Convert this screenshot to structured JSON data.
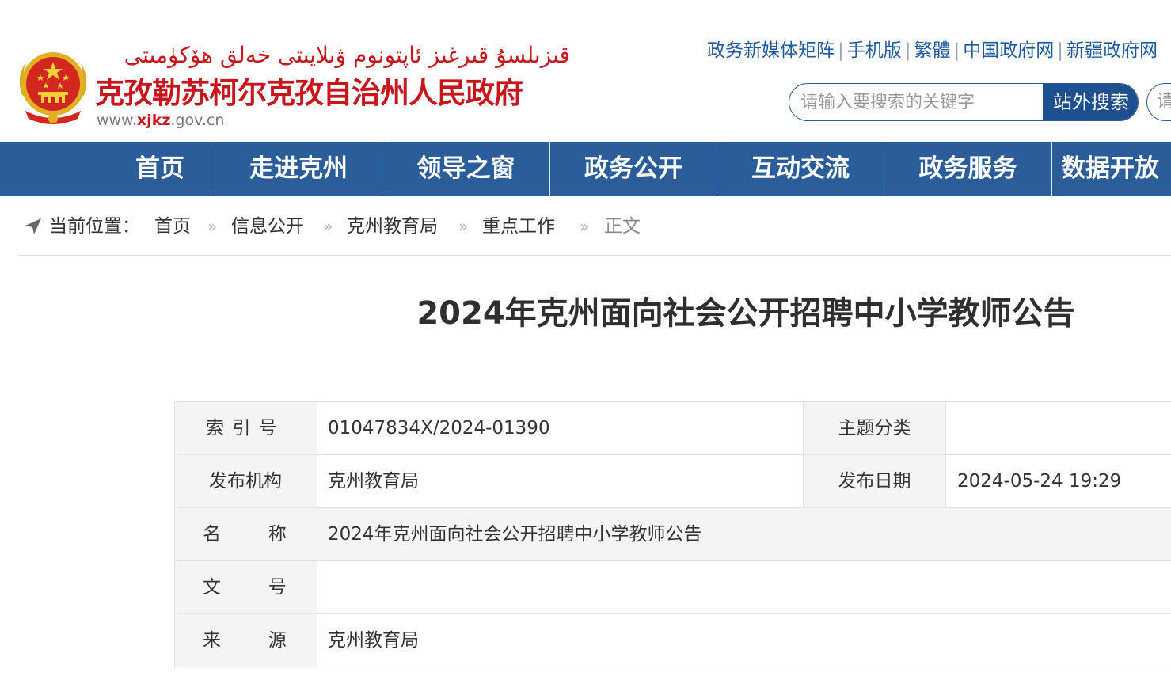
{
  "header": {
    "site_name_uyghur": "قىزىلسۇ قىرغىز ئاپتونوم ۋىلايىتى خەلق ھۆكۈمىتى",
    "site_name": "克孜勒苏柯尔克孜自治州人民政府",
    "site_url": {
      "prefix": "www.",
      "accent": "xjkz",
      "suffix": ".gov.cn"
    },
    "top_links": [
      "政务新媒体矩阵",
      "手机版",
      "繁體",
      "中国政府网",
      "新疆政府网"
    ],
    "search": {
      "placeholder": "请输入要搜索的关键字",
      "button": "站外搜索",
      "second_placeholder": "请"
    }
  },
  "nav": {
    "items": [
      "首页",
      "走进克州",
      "领导之窗",
      "政务公开",
      "互动交流",
      "政务服务",
      "数据开放"
    ]
  },
  "breadcrumb": {
    "label": "当前位置：",
    "items": [
      "首页",
      "信息公开",
      "克州教育局",
      "重点工作"
    ],
    "current": "正文",
    "separator": "»"
  },
  "article": {
    "title": "2024年克州面向社会公开招聘中小学教师公告",
    "meta": {
      "index_label": "索引号",
      "index_value": "01047834X/2024-01390",
      "topic_label": "主题分类",
      "topic_value": "",
      "publisher_label": "发布机构",
      "publisher_value": "克州教育局",
      "date_label": "发布日期",
      "date_value": "2024-05-24 19:29",
      "name_label": "名称",
      "name_value": "2024年克州面向社会公开招聘中小学教师公告",
      "doc_no_label": "文号",
      "doc_no_value": "",
      "source_label": "来源",
      "source_value": "克州教育局"
    }
  },
  "colors": {
    "brand_red": "#c8161d",
    "nav_blue": "#2b5d9b",
    "link_blue": "#1e5aa0"
  }
}
